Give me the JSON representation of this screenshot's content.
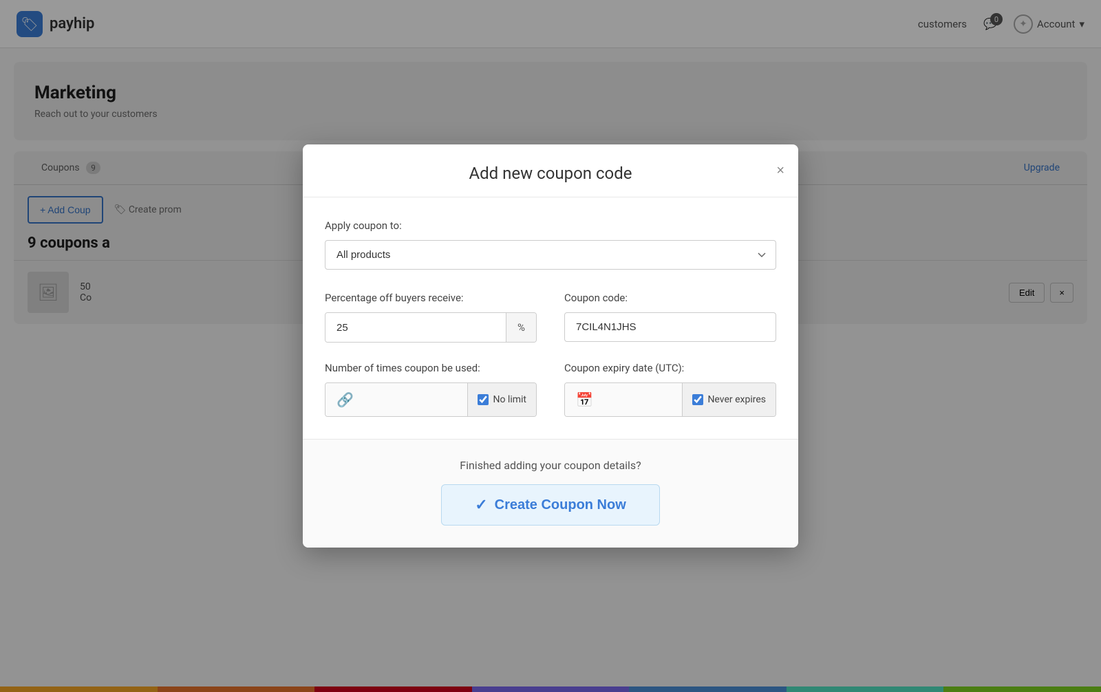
{
  "nav": {
    "logo_text": "payhip",
    "links": [
      "customers"
    ],
    "notifications_count": "0",
    "account_label": "Account"
  },
  "background": {
    "marketing_title": "Marketing",
    "marketing_sub": "Reach out to your customers",
    "tab_coupons": "Coupons",
    "tab_coupons_count": "9",
    "tab_upgrade": "Upgrade",
    "add_coupon_btn": "+ Add Coup",
    "create_promo": "Create prom",
    "coupons_count": "9 coupons a",
    "coupon_code": "Co",
    "coupon_code_num": "50",
    "edit_btn": "Edit",
    "delete_btn": "×"
  },
  "modal": {
    "title": "Add new coupon code",
    "close": "×",
    "apply_label": "Apply coupon to:",
    "apply_options": [
      "All products"
    ],
    "apply_selected": "All products",
    "percentage_label": "Percentage off buyers receive:",
    "percentage_value": "25",
    "percentage_symbol": "%",
    "coupon_code_label": "Coupon code:",
    "coupon_code_value": "7CIL4N1JHS",
    "usage_label": "Number of times coupon be used:",
    "usage_no_limit_label": "No limit",
    "usage_no_limit_checked": true,
    "expiry_label": "Coupon expiry date (UTC):",
    "expiry_never_label": "Never expires",
    "expiry_never_checked": true,
    "footer_text": "Finished adding your coupon details?",
    "create_btn_label": "Create Coupon Now",
    "create_btn_check": "✓"
  },
  "rainbow": {
    "colors": [
      "#f5a623",
      "#e85d26",
      "#d0021b",
      "#7b68ee",
      "#4a90d9",
      "#50e3c2",
      "#7ed321"
    ]
  }
}
